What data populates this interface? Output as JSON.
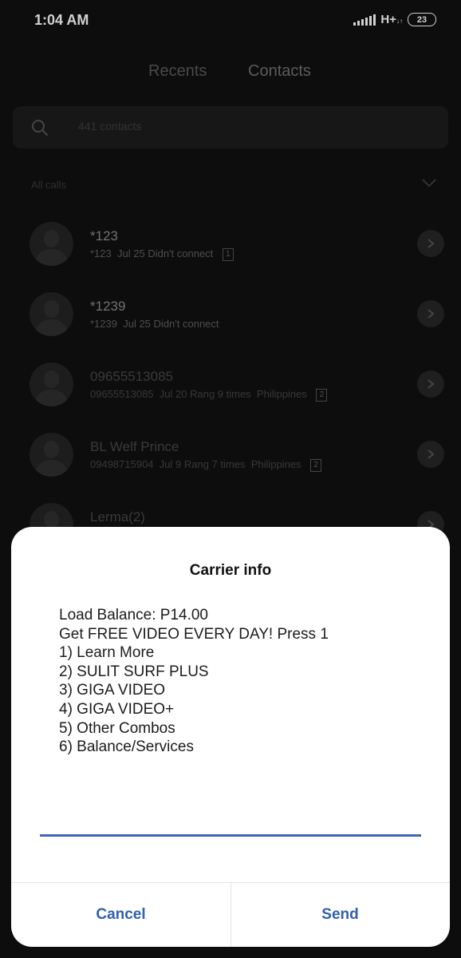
{
  "status_bar": {
    "time": "1:04 AM",
    "network": "H+",
    "battery": "23"
  },
  "tabs": [
    {
      "label": "Recents"
    },
    {
      "label": "Contacts"
    }
  ],
  "search": {
    "placeholder": "441 contacts"
  },
  "filter": {
    "label": "All calls"
  },
  "calls": [
    {
      "name": "*123",
      "number": "*123",
      "date": "Jul 25",
      "detail": "Didn't connect",
      "location": "",
      "sim": "1"
    },
    {
      "name": "*1239",
      "number": "*1239",
      "date": "Jul 25",
      "detail": "Didn't connect",
      "location": "",
      "sim": ""
    },
    {
      "name": "09655513085",
      "number": "09655513085",
      "date": "Jul 20",
      "detail": "Rang 9 times",
      "location": "Philippines",
      "sim": "2"
    },
    {
      "name": "BL Welf Prince",
      "number": "09498715904",
      "date": "Jul 9",
      "detail": "Rang 7 times",
      "location": "Philippines",
      "sim": "2"
    },
    {
      "name": "Lerma(2)"
    }
  ],
  "dialog": {
    "title": "Carrier info",
    "message_lines": [
      "Load Balance: P14.00",
      "Get FREE VIDEO EVERY DAY! Press 1",
      "1) Learn More",
      "2) SULIT SURF PLUS",
      "3) GIGA VIDEO",
      "4) GIGA VIDEO+",
      "5) Other Combos",
      "6) Balance/Services"
    ],
    "reply_value": "",
    "cancel_label": "Cancel",
    "send_label": "Send"
  },
  "colors": {
    "accent": "#3160b1",
    "input_underline": "#3c67b4",
    "background": "#101010",
    "dialog_bg": "#ffffff"
  },
  "icons": [
    "search-icon",
    "chevron-down-icon",
    "chevron-right-icon",
    "avatar-placeholder-icon",
    "signal-icon",
    "battery-icon"
  ]
}
